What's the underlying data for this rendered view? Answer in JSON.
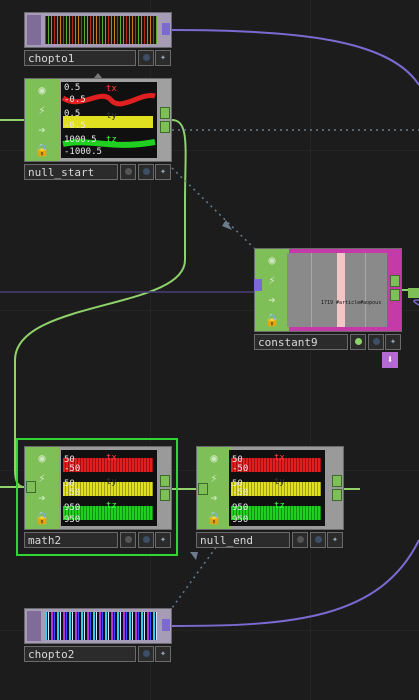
{
  "nodes": {
    "chopto1": {
      "name": "chopto1"
    },
    "null_start": {
      "name": "null_start",
      "channels": [
        "tx",
        "ty",
        "tz"
      ],
      "values": [
        "0.5",
        "-0.5",
        "0.5",
        "-0.5",
        "1000.5",
        "-1000.5"
      ]
    },
    "constant9": {
      "name": "constant9",
      "preview_text": "1719 #article#aopous"
    },
    "math2": {
      "name": "math2",
      "channels": [
        "tx",
        "ty",
        "tz"
      ],
      "values": [
        "50",
        "-50",
        "50",
        "-50",
        "950",
        "950"
      ]
    },
    "null_end": {
      "name": "null_end",
      "channels": [
        "tx",
        "ty",
        "tz"
      ],
      "values": [
        "50",
        "-50",
        "50",
        "-50",
        "950",
        "950"
      ]
    },
    "chopto2": {
      "name": "chopto2"
    }
  },
  "colors": {
    "chop_family": "#8fd16a",
    "dat_family": "#b36bd1",
    "wire_chop": "#8fd16a",
    "wire_dat": "#7a6ad1",
    "wire_ref": "#6b7c8c",
    "selection": "#32d632",
    "channel_x": "#e02020",
    "channel_y": "#e0e020",
    "channel_z": "#20d020"
  },
  "icons": [
    "viewer-icon",
    "bypass-icon",
    "cook-icon",
    "lock-icon",
    "expand-icon",
    "move-icon"
  ]
}
